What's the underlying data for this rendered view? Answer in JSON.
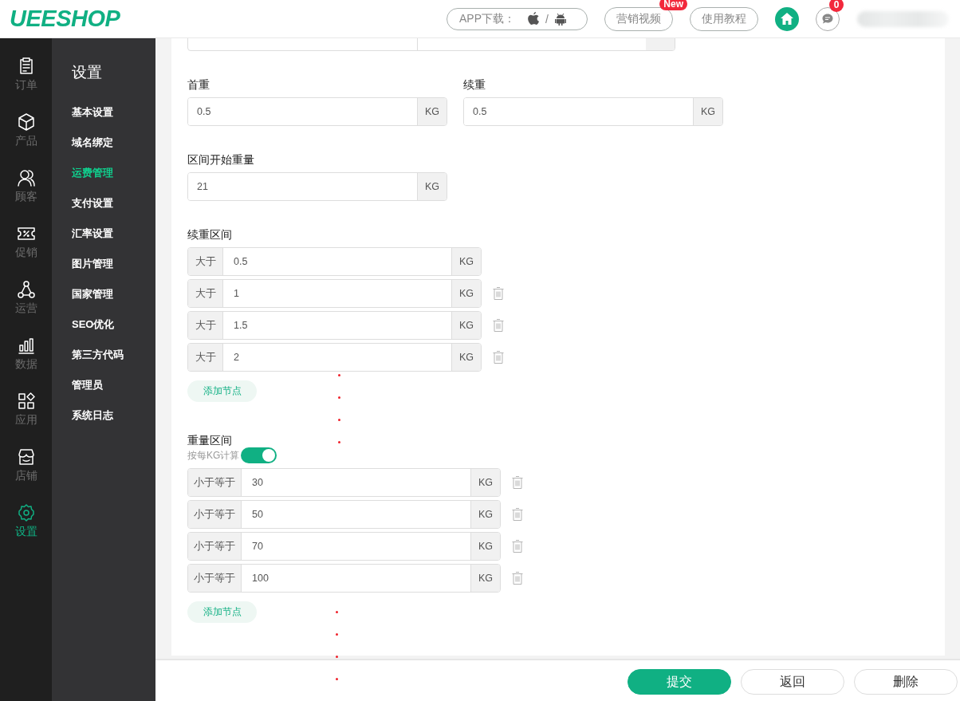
{
  "header": {
    "logo": "UEESHOP",
    "app_download": {
      "label": "APP下载：",
      "separator": "/"
    },
    "links": [
      {
        "label": "营销视频",
        "badge": "New"
      },
      {
        "label": "使用教程"
      }
    ],
    "messages_badge": "0"
  },
  "rail": [
    {
      "label": "订单",
      "selected": false
    },
    {
      "label": "产品",
      "selected": false
    },
    {
      "label": "顾客",
      "selected": false
    },
    {
      "label": "促销",
      "selected": false
    },
    {
      "label": "运营",
      "selected": false
    },
    {
      "label": "数据",
      "selected": false
    },
    {
      "label": "应用",
      "selected": false
    },
    {
      "label": "店铺",
      "selected": false
    },
    {
      "label": "设置",
      "selected": true
    }
  ],
  "subnav": {
    "title": "设置",
    "items": [
      {
        "label": "基本设置",
        "selected": false
      },
      {
        "label": "域名绑定",
        "selected": false
      },
      {
        "label": "运费管理",
        "selected": true
      },
      {
        "label": "支付设置",
        "selected": false
      },
      {
        "label": "汇率设置",
        "selected": false
      },
      {
        "label": "图片管理",
        "selected": false
      },
      {
        "label": "国家管理",
        "selected": false
      },
      {
        "label": "SEO优化",
        "selected": false
      },
      {
        "label": "第三方代码",
        "selected": false
      },
      {
        "label": "管理员",
        "selected": false
      },
      {
        "label": "系统日志",
        "selected": false
      }
    ]
  },
  "form": {
    "weights": [
      {
        "label": "首重",
        "value": "0.5",
        "unit": "KG"
      },
      {
        "label": "续重",
        "value": "0.5",
        "unit": "KG"
      }
    ],
    "start_weight": {
      "label": "区间开始重量",
      "value": "21",
      "unit": "KG"
    },
    "continued_ranges": {
      "title": "续重区间",
      "add_button": "添加节点",
      "rows": [
        {
          "prefix": "大于",
          "value": "0.5",
          "unit": "KG",
          "deletable": false
        },
        {
          "prefix": "大于",
          "value": "1",
          "unit": "KG",
          "deletable": true
        },
        {
          "prefix": "大于",
          "value": "1.5",
          "unit": "KG",
          "deletable": true
        },
        {
          "prefix": "大于",
          "value": "2",
          "unit": "KG",
          "deletable": true
        }
      ]
    },
    "weight_ranges": {
      "title": "重量区间",
      "per_kg": {
        "label": "按每KG计算",
        "on": true
      },
      "add_button": "添加节点",
      "rows": [
        {
          "prefix": "小于等于",
          "value": "30",
          "unit": "KG",
          "deletable": true
        },
        {
          "prefix": "小于等于",
          "value": "50",
          "unit": "KG",
          "deletable": true
        },
        {
          "prefix": "小于等于",
          "value": "70",
          "unit": "KG",
          "deletable": true
        },
        {
          "prefix": "小于等于",
          "value": "100",
          "unit": "KG",
          "deletable": true
        }
      ]
    }
  },
  "footer": [
    {
      "label": "提交",
      "kind": "primary"
    },
    {
      "label": "返回",
      "kind": "secondary"
    },
    {
      "label": "删除",
      "kind": "secondary"
    }
  ]
}
